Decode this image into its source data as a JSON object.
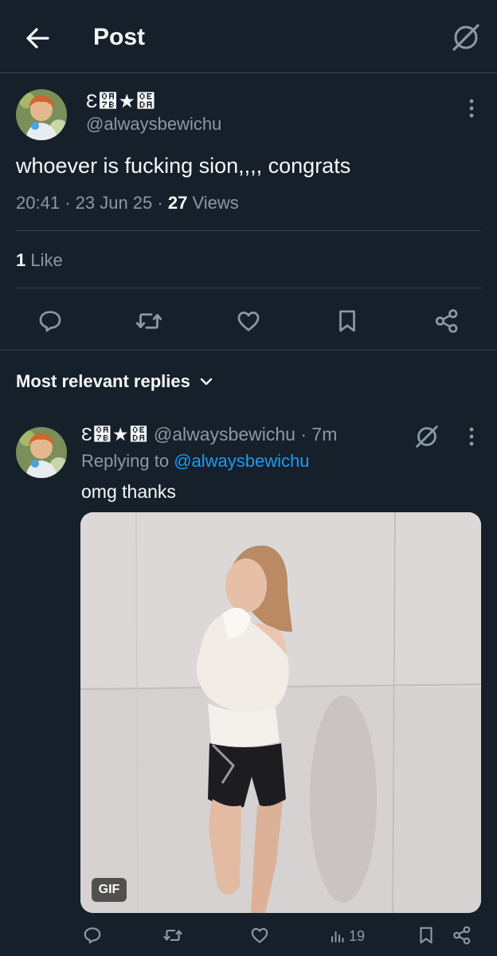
{
  "header": {
    "title": "Post"
  },
  "post": {
    "display_name": "Ɛ੻★໚",
    "handle": "@alwaysbewichu",
    "text": "whoever is fucking sion,,,, congrats",
    "time": "20:41",
    "date": "23 Jun 25",
    "views_count": "27",
    "views_label": "Views",
    "likes_count": "1",
    "likes_label": "Like",
    "sep": "·"
  },
  "replies_sort": {
    "label": "Most relevant replies"
  },
  "reply": {
    "display_name": "Ɛ੻★໚",
    "handle": "@alwaysbewichu",
    "sep": " · ",
    "age": "7m",
    "replying_prefix": "Replying to ",
    "replying_to": "@alwaysbewichu",
    "text": "omg thanks",
    "media_badge": "GIF",
    "views": "19"
  },
  "colors": {
    "background": "#15202b",
    "text_primary": "#f7f9f9",
    "text_secondary": "#8b98a5",
    "link": "#1d9bf0",
    "divider": "#38444d"
  },
  "icons": [
    "back-arrow-icon",
    "grok-icon",
    "more-icon",
    "reply-icon",
    "retweet-icon",
    "like-icon",
    "bookmark-icon",
    "share-icon",
    "views-icon",
    "chevron-down-icon"
  ]
}
